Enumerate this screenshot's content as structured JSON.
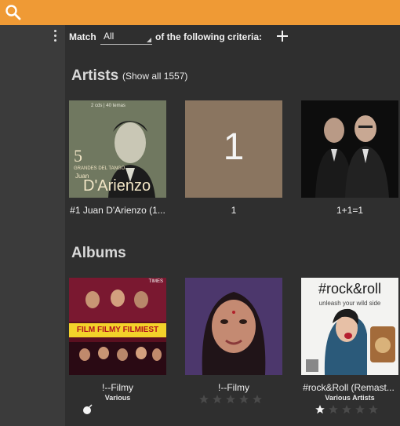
{
  "colors": {
    "topbar": "#ef9a35",
    "sidebar": "#3b3b3b",
    "main": "#2f2f2f",
    "star_empty": "#4a4a4a",
    "star_filled": "#f5f5f5"
  },
  "header": {
    "search_icon": "search-icon"
  },
  "filter": {
    "match_label": "Match",
    "match_value": "All",
    "criteria_label": "of the following criteria:"
  },
  "artists": {
    "title": "Artists",
    "show_all": "(Show all 1557)",
    "items": [
      {
        "label": "#1 Juan D'Arienzo (1...",
        "art_text_top": "2 cds | 40 temas",
        "art_number": "5",
        "art_text_mid": "GRANDES DEL TANGO",
        "art_name_small": "Juan",
        "art_name_large": "D'Arienzo"
      },
      {
        "label": "1",
        "art_number": "1"
      },
      {
        "label": "1+1=1"
      }
    ]
  },
  "albums": {
    "title": "Albums",
    "items": [
      {
        "title": "!--Filmy",
        "artist": "Various",
        "art_banner": "FILM FILMY FILMIEST",
        "art_corner": "TIMES"
      },
      {
        "title": "!--Filmy",
        "artist": "",
        "rating": 0
      },
      {
        "title": "#rock&Roll (Remast...",
        "artist": "Various Artists",
        "art_title": "#rock&roll",
        "art_tagline": "unleash your wild side",
        "rating": 1
      }
    ]
  }
}
